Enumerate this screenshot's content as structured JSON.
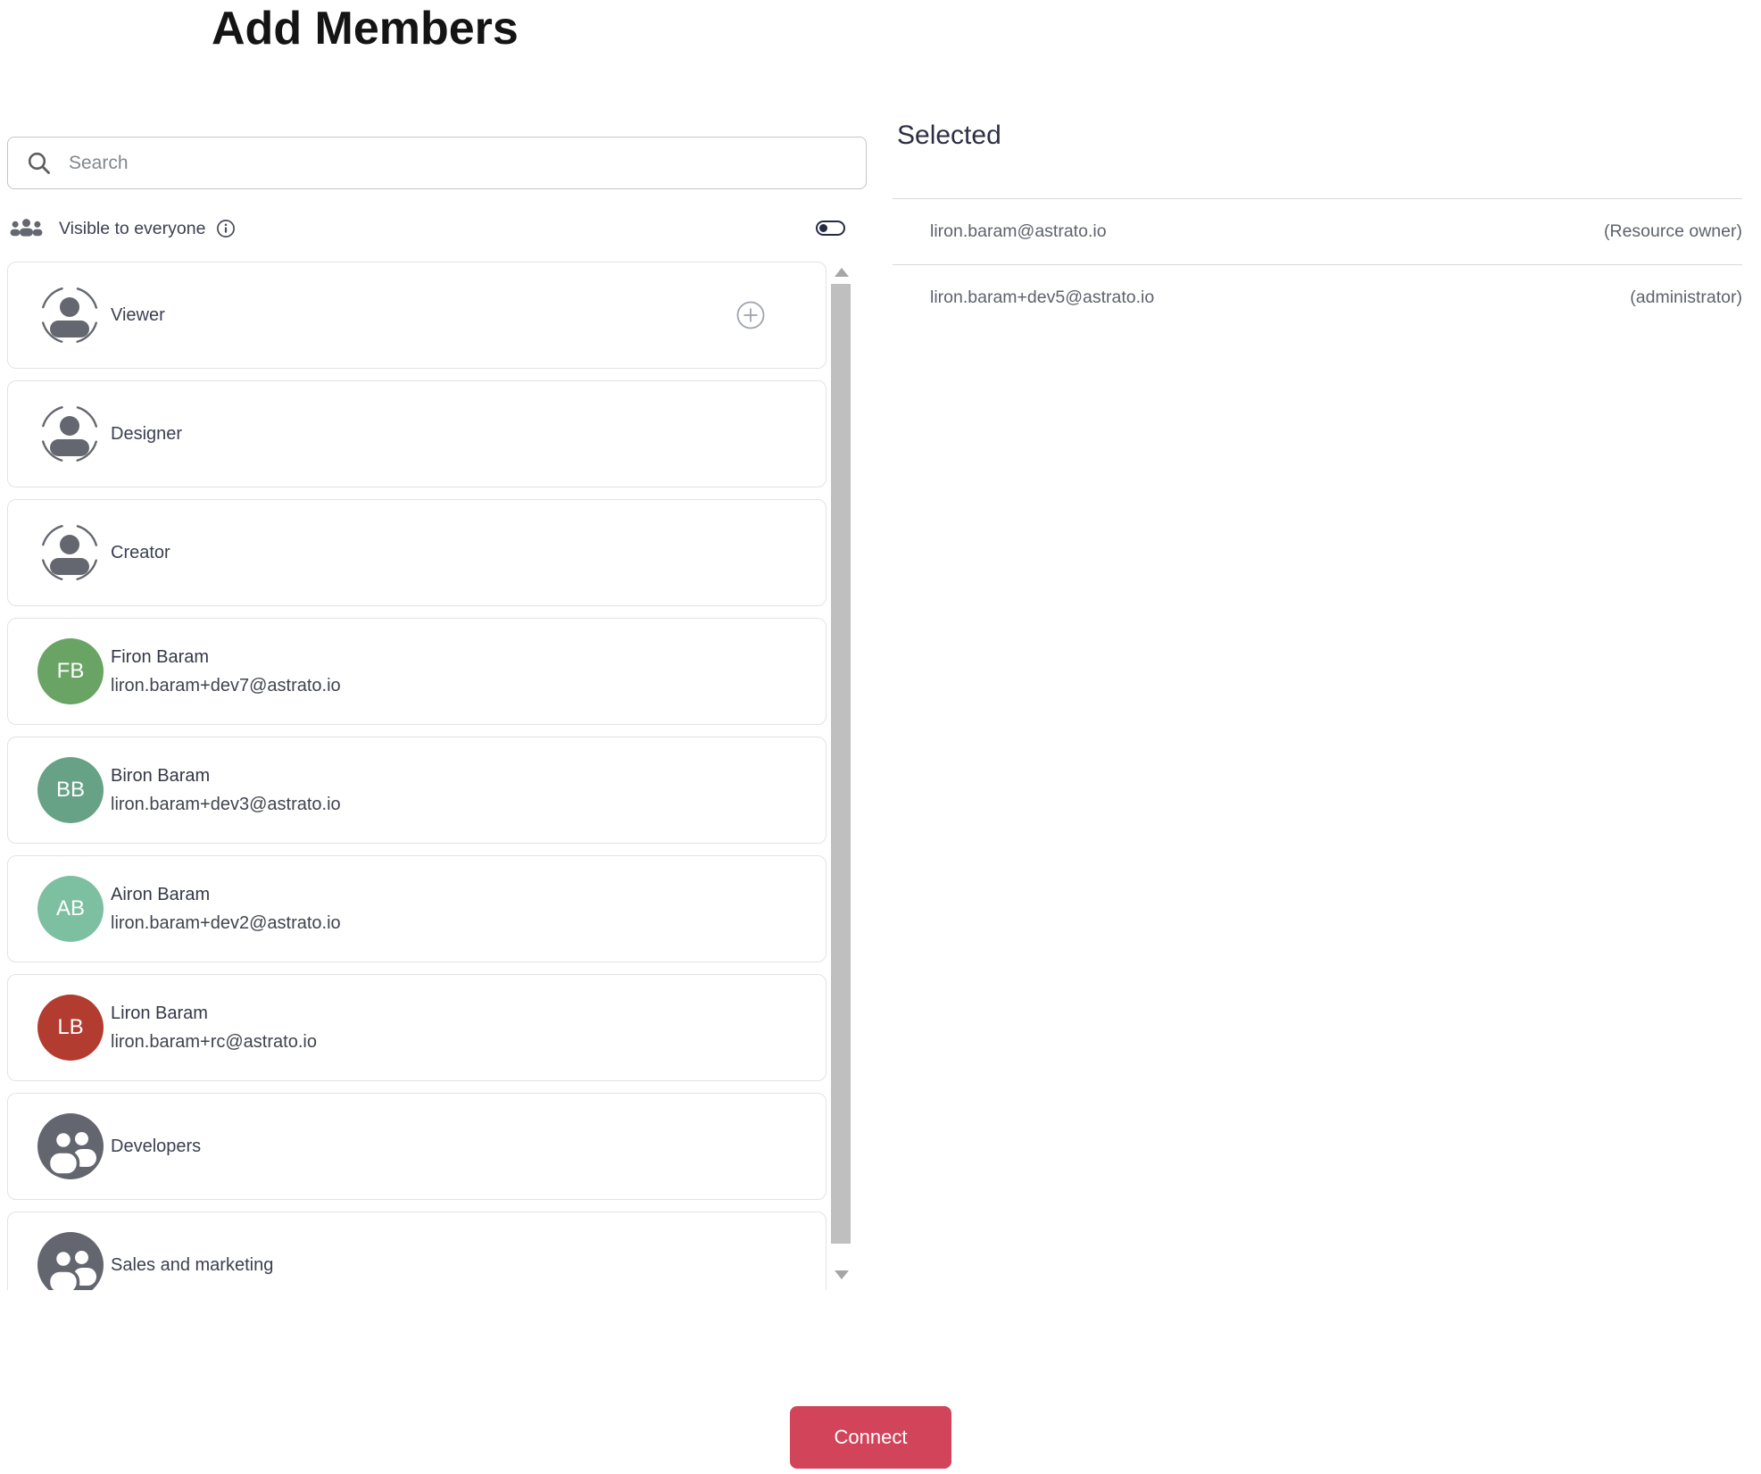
{
  "title": "Add Members",
  "search": {
    "placeholder": "Search",
    "value": ""
  },
  "visibility": {
    "label": "Visible to everyone",
    "toggle_state": "off"
  },
  "list": {
    "items": [
      {
        "type": "role",
        "label": "Viewer",
        "has_add_button": true
      },
      {
        "type": "role",
        "label": "Designer"
      },
      {
        "type": "role",
        "label": "Creator"
      },
      {
        "type": "user",
        "name": "Firon Baram",
        "email": "liron.baram+dev7@astrato.io",
        "initials": "FB",
        "avatar_color": "#69a464"
      },
      {
        "type": "user",
        "name": "Biron Baram",
        "email": "liron.baram+dev3@astrato.io",
        "initials": "BB",
        "avatar_color": "#67a287"
      },
      {
        "type": "user",
        "name": "Airon Baram",
        "email": "liron.baram+dev2@astrato.io",
        "initials": "AB",
        "avatar_color": "#7dbfa1"
      },
      {
        "type": "user",
        "name": "Liron Baram",
        "email": "liron.baram+rc@astrato.io",
        "initials": "LB",
        "avatar_color": "#b23c2f"
      },
      {
        "type": "group",
        "label": "Developers"
      },
      {
        "type": "group",
        "label": "Sales and marketing"
      }
    ]
  },
  "selected": {
    "heading": "Selected",
    "rows": [
      {
        "email": "liron.baram@astrato.io",
        "role": "(Resource owner)"
      },
      {
        "email": "liron.baram+dev5@astrato.io",
        "role": "(administrator)"
      }
    ]
  },
  "footer": {
    "connect_label": "Connect"
  },
  "icons": [
    "search-icon",
    "groups-icon",
    "info-icon",
    "toggle-switch",
    "person-dashed-circle-icon",
    "add-plus-icon",
    "group-avatar-icon",
    "scrollbar-arrows"
  ],
  "colors": {
    "connect_button": "#d14459",
    "toggle": "#262b44",
    "scrollbar_thumb": "#bfbfbf",
    "card_border": "#e3e3e3",
    "text_dark": "#3b4052"
  }
}
